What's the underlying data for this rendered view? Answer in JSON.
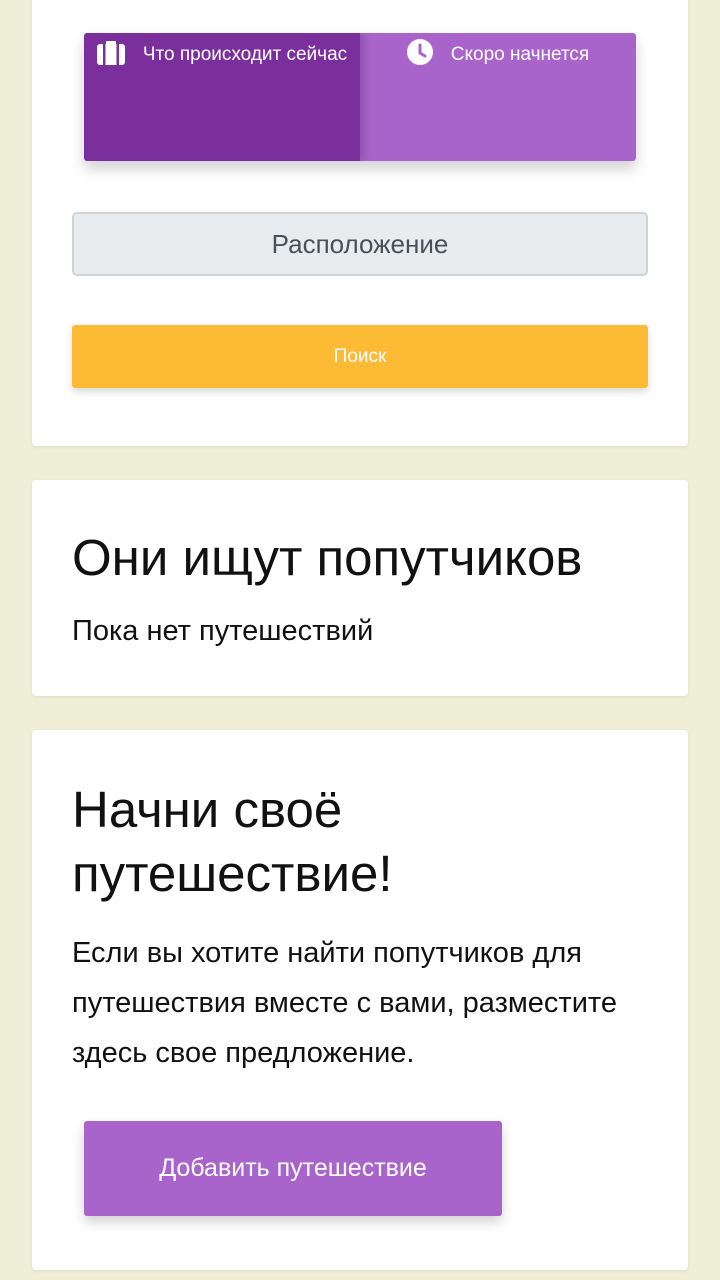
{
  "search_card": {
    "tabs": [
      {
        "label": "Что происходит сейчас",
        "icon": "suitcase-icon",
        "active": true
      },
      {
        "label": "Скоро начнется",
        "icon": "clock-icon",
        "active": false
      }
    ],
    "location_placeholder": "Расположение",
    "search_label": "Поиск"
  },
  "companions_card": {
    "title": "Они ищут попутчиков",
    "empty_text": "Пока нет путешествий"
  },
  "start_card": {
    "title": "Начни своё путешествие!",
    "description": "Если вы хотите найти попутчиков для путешествия вместе с вами, разместите здесь свое предложение.",
    "add_label": "Добавить путешествие"
  },
  "colors": {
    "background": "#efeed6",
    "tab_active": "#7b2f9c",
    "tab_inactive": "#a964cb",
    "search_button": "#fdbb35",
    "add_button": "#a964cb"
  }
}
